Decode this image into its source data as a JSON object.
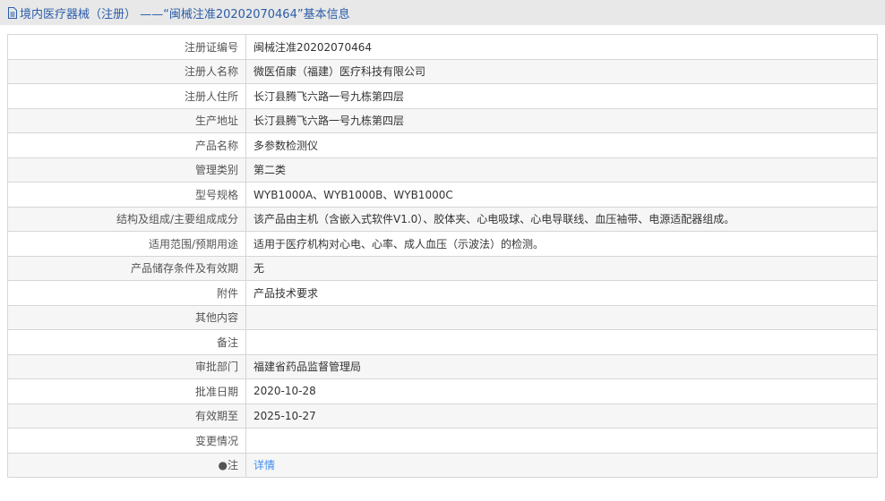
{
  "header": {
    "title": "境内医疗器械（注册） ——“闽械注准20202070464”基本信息"
  },
  "rows": [
    {
      "label": "注册证编号",
      "value": "闽械注准20202070464"
    },
    {
      "label": "注册人名称",
      "value": "微医佰康（福建）医疗科技有限公司"
    },
    {
      "label": "注册人住所",
      "value": "长汀县腾飞六路一号九栋第四层"
    },
    {
      "label": "生产地址",
      "value": "长汀县腾飞六路一号九栋第四层"
    },
    {
      "label": "产品名称",
      "value": "多参数检测仪"
    },
    {
      "label": "管理类别",
      "value": "第二类"
    },
    {
      "label": "型号规格",
      "value": "WYB1000A、WYB1000B、WYB1000C"
    },
    {
      "label": "结构及组成/主要组成成分",
      "value": "该产品由主机（含嵌入式软件V1.0）、胶体夹、心电吸球、心电导联线、血压袖带、电源适配器组成。"
    },
    {
      "label": "适用范围/预期用途",
      "value": "适用于医疗机构对心电、心率、成人血压（示波法）的检测。"
    },
    {
      "label": "产品储存条件及有效期",
      "value": "无"
    },
    {
      "label": "附件",
      "value": "产品技术要求"
    },
    {
      "label": "其他内容",
      "value": ""
    },
    {
      "label": "备注",
      "value": ""
    },
    {
      "label": "审批部门",
      "value": "福建省药品监督管理局"
    },
    {
      "label": "批准日期",
      "value": "2020-10-28"
    },
    {
      "label": "有效期至",
      "value": "2025-10-27"
    },
    {
      "label": "变更情况",
      "value": ""
    }
  ],
  "note": {
    "label": "注",
    "link": "详情"
  }
}
